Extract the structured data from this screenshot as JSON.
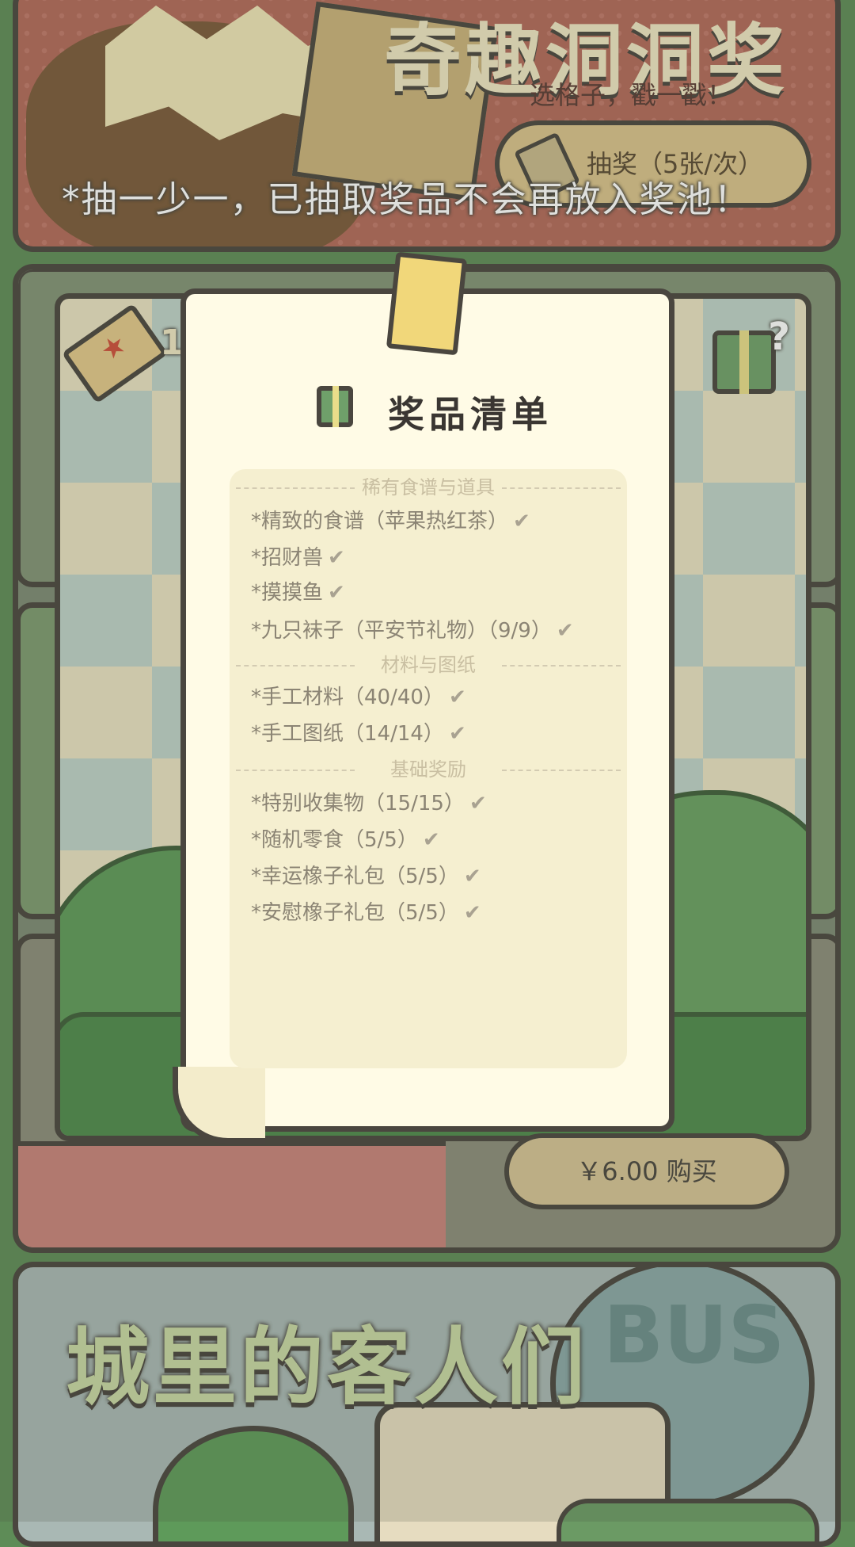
{
  "banner": {
    "title": "奇趣洞洞奖",
    "subtitle": "选格子，戳一戳！",
    "draw_button": "抽奖（5张/次）",
    "note": "*抽一少一，已抽取奖品不会再放入奖池！"
  },
  "game": {
    "ticket_count": "1",
    "gift_badge": "?",
    "buy_button": "￥6.00 购买"
  },
  "prize_list": {
    "title": "奖品清单",
    "sections": [
      {
        "header": "稀有食谱与道具",
        "items": [
          "*精致的食谱（苹果热红茶）",
          "*招财兽",
          "*摸摸鱼",
          "*九只袜子（平安节礼物）（9/9）"
        ]
      },
      {
        "header": "材料与图纸",
        "items": [
          "*手工材料（40/40）",
          "*手工图纸（14/14）"
        ]
      },
      {
        "header": "基础奖励",
        "items": [
          "*特别收集物（15/15）",
          "*随机零食（5/5）",
          "*幸运橡子礼包（5/5）",
          "*安慰橡子礼包（5/5）"
        ]
      }
    ],
    "check_mark": "✔"
  },
  "bottom": {
    "title": "城里的客人们",
    "bus_sign": "BUS"
  }
}
